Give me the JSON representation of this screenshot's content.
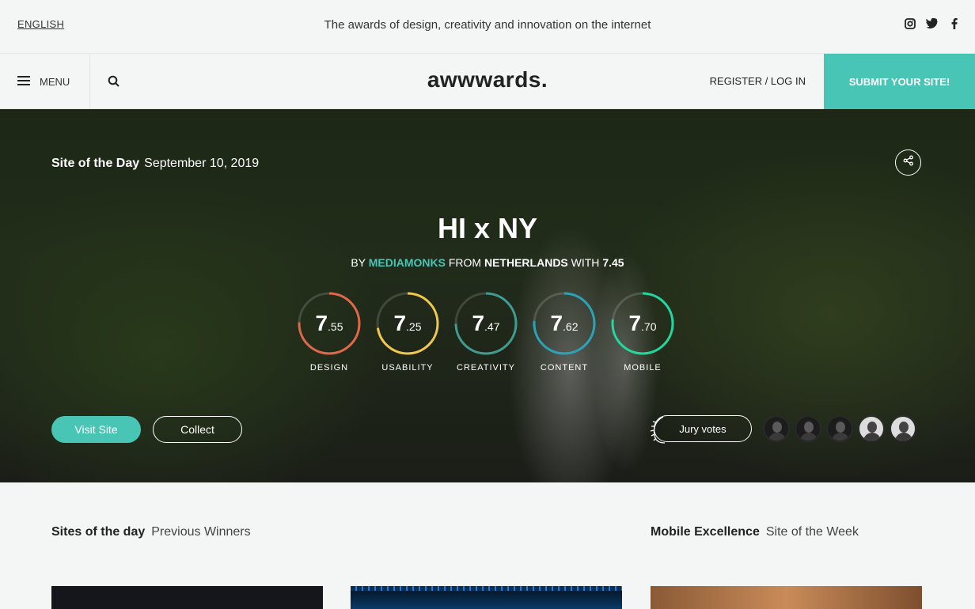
{
  "topbar": {
    "language": "ENGLISH",
    "tagline": "The awards of design, creativity and innovation on the internet",
    "social": [
      "instagram-icon",
      "twitter-icon",
      "facebook-icon"
    ]
  },
  "nav": {
    "menu_label": "MENU",
    "logo": "awwwards.",
    "login": "REGISTER / LOG IN",
    "submit": "SUBMIT YOUR SITE!"
  },
  "hero": {
    "badge": "Site of the Day",
    "date": "September 10, 2019",
    "title": "HI x NY",
    "by_prefix": "BY",
    "author": "MEDIAMONKS",
    "from_prefix": "FROM",
    "country": "NETHERLANDS",
    "with_prefix": "WITH",
    "score": "7.45",
    "scores": [
      {
        "label": "DESIGN",
        "int": "7",
        "dec": ".55",
        "value": 7.55,
        "color": "#e0684a"
      },
      {
        "label": "USABILITY",
        "int": "7",
        "dec": ".25",
        "value": 7.25,
        "color": "#f2c84b"
      },
      {
        "label": "CREATIVITY",
        "int": "7",
        "dec": ".47",
        "value": 7.47,
        "color": "#3f9c93"
      },
      {
        "label": "CONTENT",
        "int": "7",
        "dec": ".62",
        "value": 7.62,
        "color": "#2aa3b8"
      },
      {
        "label": "MOBILE",
        "int": "7",
        "dec": ".70",
        "value": 7.7,
        "color": "#21d9a0"
      }
    ],
    "visit_label": "Visit Site",
    "collect_label": "Collect",
    "jury_label": "Jury votes"
  },
  "sections": {
    "left_title": "Sites of the day",
    "left_sub": "Previous Winners",
    "right_title": "Mobile Excellence",
    "right_sub": "Site of the Week"
  },
  "colors": {
    "accent": "#49c5b6"
  }
}
